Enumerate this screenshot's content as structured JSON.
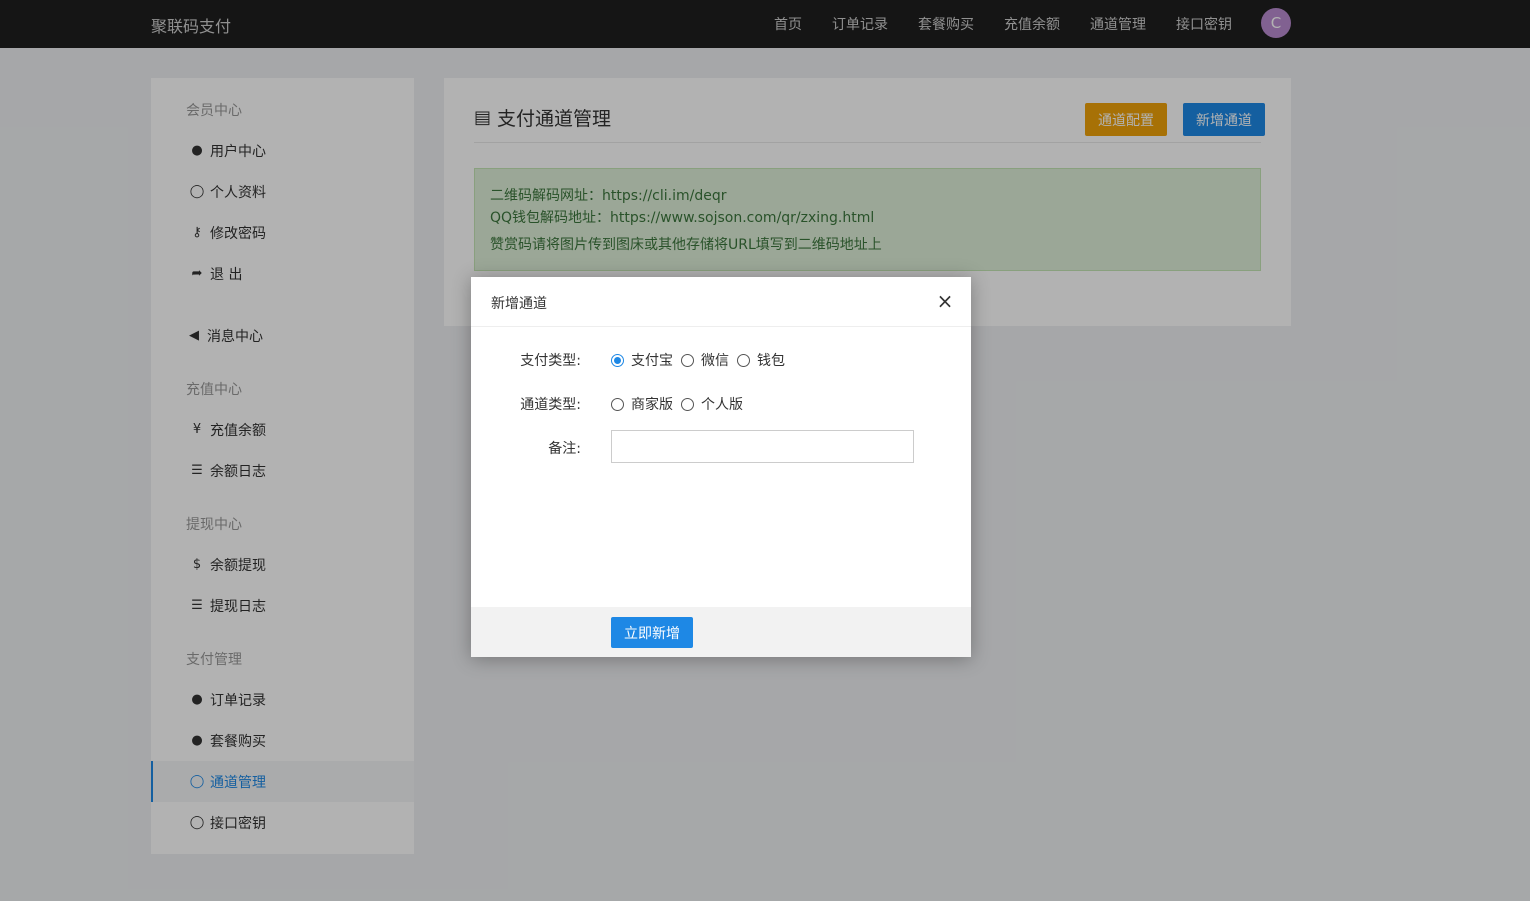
{
  "header": {
    "brand": "聚联码支付",
    "nav": [
      "首页",
      "订单记录",
      "套餐购买",
      "充值余额",
      "通道管理",
      "接口密钥"
    ],
    "avatar_letter": "C"
  },
  "sidebar": {
    "sections": {
      "member": "会员中心",
      "recharge": "充值中心",
      "withdraw": "提现中心",
      "payment": "支付管理"
    },
    "items": {
      "user_center": "用户中心",
      "profile": "个人资料",
      "password": "修改密码",
      "logout": "退 出",
      "messages": "消息中心",
      "recharge_balance": "充值余额",
      "balance_log": "余额日志",
      "withdraw_balance": "余额提现",
      "withdraw_log": "提现日志",
      "orders": "订单记录",
      "package": "套餐购买",
      "channel": "通道管理",
      "api_key": "接口密钥"
    },
    "active": "通道管理"
  },
  "main": {
    "title": "支付通道管理",
    "btn_config": "通道配置",
    "btn_add": "新增通道",
    "alert": {
      "line1": "二维码解码网址：https://cli.im/deqr",
      "line2": "QQ钱包解码地址：https://www.sojson.com/qr/zxing.html",
      "line3": "赞赏码请将图片传到图床或其他存储将URL填写到二维码地址上"
    }
  },
  "modal": {
    "title": "新增通道",
    "close": "×",
    "pay_type_label": "支付类型:",
    "pay_types": [
      "支付宝",
      "微信",
      "钱包"
    ],
    "pay_type_selected": "支付宝",
    "channel_type_label": "通道类型:",
    "channel_types": [
      "商家版",
      "个人版"
    ],
    "remark_label": "备注:",
    "remark_value": "",
    "submit": "立即新增"
  },
  "colors": {
    "topbar": "#1f1f1f",
    "accent_blue": "#1e88e5",
    "accent_orange": "#f0a30a",
    "alert_bg": "#dff0d8",
    "alert_text": "#3c763d",
    "avatar": "#b98bd0"
  }
}
